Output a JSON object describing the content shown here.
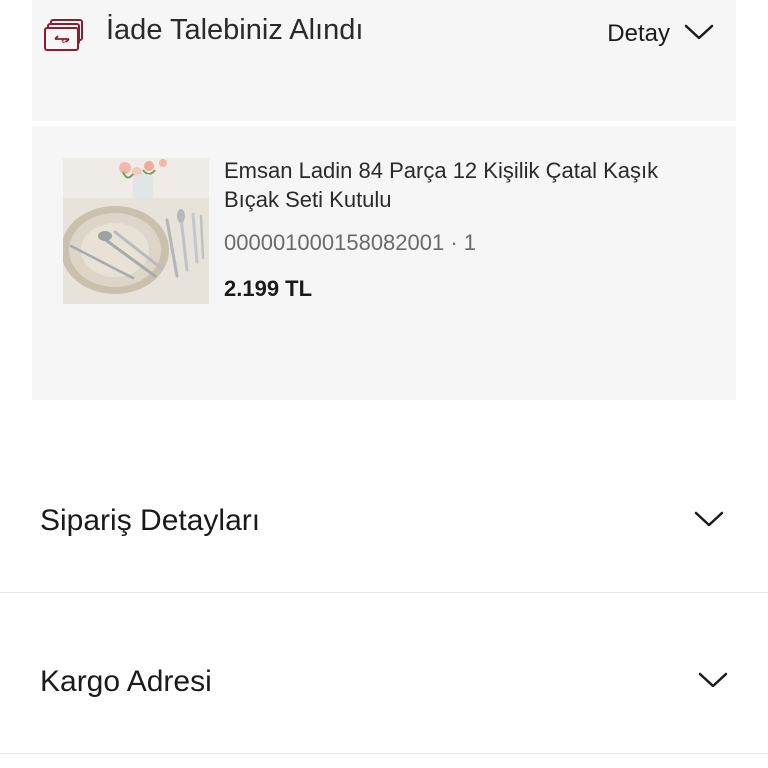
{
  "refund": {
    "icon": "refund-money-icon",
    "title": "İade Talebiniz Alındı",
    "detail_label": "Detay",
    "toggle_icon": "chevron-down-icon"
  },
  "product": {
    "name": "Emsan Ladin 84 Parça 12 Kişilik Çatal Kaşık Bıçak Seti Kutulu",
    "code": "000001000158082001 · 1",
    "price": "2.199 TL"
  },
  "sections": {
    "order_details": {
      "label": "Sipariş Detayları",
      "icon": "chevron-down-icon"
    },
    "shipping_address": {
      "label": "Kargo Adresi",
      "icon": "chevron-down-icon"
    }
  },
  "colors": {
    "icon_accent": "#8c1d2e",
    "card_bg": "#f6f6f6",
    "text": "#1a1a1a"
  }
}
